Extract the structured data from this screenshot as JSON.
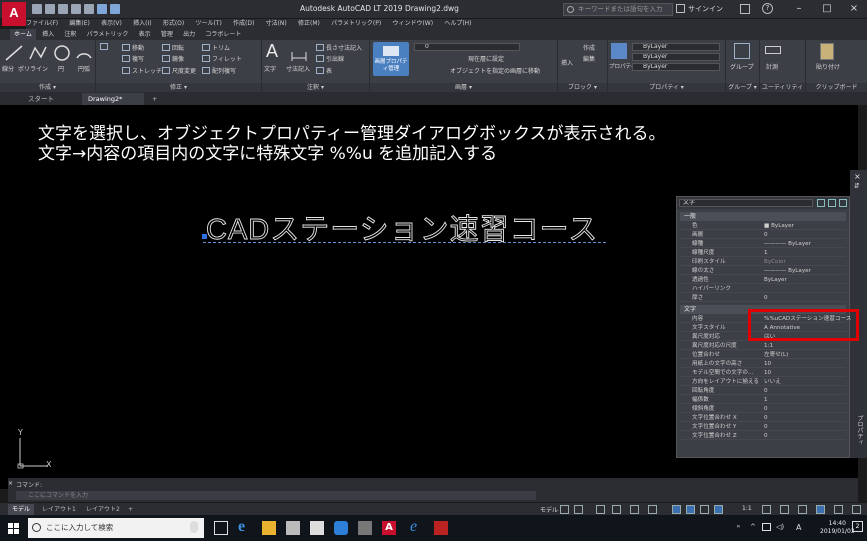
{
  "window": {
    "title": "Autodesk AutoCAD LT 2019    Drawing2.dwg",
    "app_logo": "A",
    "search_placeholder": "キーワードまたは語句を入力",
    "signin_label": "サインイン",
    "controls": [
      "–",
      "□",
      "×"
    ]
  },
  "menubar": [
    "ファイル(F)",
    "編集(E)",
    "表示(V)",
    "挿入(I)",
    "形式(O)",
    "ツール(T)",
    "作成(D)",
    "寸法(N)",
    "修正(M)",
    "パラメトリック(P)",
    "ウィンドウ(W)",
    "ヘルプ(H)"
  ],
  "ribbon_tabs": [
    "ホーム",
    "挿入",
    "注釈",
    "パラメトリック",
    "表示",
    "管理",
    "出力",
    "コラボレート"
  ],
  "ribbon": {
    "draw": {
      "title": "作成 ▾",
      "big_tools": [
        "線分",
        "ポリライン",
        "円",
        "円弧"
      ]
    },
    "modify": {
      "title": "修正 ▾",
      "tools": [
        "移動",
        "回転",
        "トリム",
        "複写",
        "鏡像",
        "フィレット",
        "ストレッチ",
        "尺度変更",
        "配列複写"
      ]
    },
    "annotation": {
      "title": "注釈 ▾",
      "big_tools": [
        "文字",
        "寸法記入"
      ],
      "tools": [
        "長さ寸法記入",
        "引出線",
        "表"
      ]
    },
    "layers": {
      "title": "画層 ▾",
      "big_tool": "画層プロパティ管理",
      "layer_value": "0",
      "tools": [
        "現在層に設定",
        "オブジェクトを指定の画層に移動"
      ]
    },
    "block": {
      "title": "ブロック ▾",
      "tools": [
        "作成",
        "編集",
        "挿入"
      ]
    },
    "properties": {
      "title": "プロパティ ▾",
      "big_tool": "プロパティ コピー",
      "dropdowns": [
        "ByLayer",
        "ByLayer",
        "ByLayer"
      ]
    },
    "groups": {
      "title": "グループ ▾",
      "big_tool": "グループ"
    },
    "utilities": {
      "title": "ユーティリティ ▾",
      "big_tool": "計測"
    },
    "clipboard": {
      "title": "クリップボード",
      "big_tool": "貼り付け"
    }
  },
  "file_tabs": [
    "スタート",
    "Drawing2*",
    "+"
  ],
  "canvas": {
    "instruction_line1": "文字を選択し、オブジェクトプロパティー管理ダイアログボックスが表示される。",
    "instruction_line2": "文字→内容の項目内の文字に特殊文字 %%u を追加記入する",
    "cad_text": "CADステーション速習コース",
    "ucs_labels": {
      "x": "X",
      "y": "Y"
    }
  },
  "properties_palette": {
    "selector": "文字",
    "side_label": "プロパティ",
    "sections": [
      {
        "title": "一般",
        "rows": [
          {
            "key": "色",
            "value": "■ ByLayer"
          },
          {
            "key": "画層",
            "value": "0"
          },
          {
            "key": "線種",
            "value": "———— ByLayer"
          },
          {
            "key": "線種尺度",
            "value": "1"
          },
          {
            "key": "印刷スタイル",
            "value": "ByColor"
          },
          {
            "key": "線の太さ",
            "value": "———— ByLayer"
          },
          {
            "key": "透過性",
            "value": "ByLayer"
          },
          {
            "key": "ハイパーリンク",
            "value": ""
          },
          {
            "key": "厚さ",
            "value": "0"
          }
        ]
      },
      {
        "title": "文字",
        "rows": [
          {
            "key": "内容",
            "value": "%%uCADステーション速習コース"
          },
          {
            "key": "文字スタイル",
            "value": "A Annotative"
          },
          {
            "key": "異尺度対応",
            "value": "はい"
          },
          {
            "key": "異尺度対応の尺度",
            "value": "1:1"
          },
          {
            "key": "位置合わせ",
            "value": "左寄せ(L)"
          },
          {
            "key": "用紙上の文字の高さ",
            "value": "10"
          },
          {
            "key": "モデル空間での文字の...",
            "value": "10"
          },
          {
            "key": "方向をレイアウトに揃える",
            "value": "いいえ"
          },
          {
            "key": "回転角度",
            "value": "0"
          },
          {
            "key": "幅係数",
            "value": "1"
          },
          {
            "key": "傾斜角度",
            "value": "0"
          },
          {
            "key": "文字位置合わせ X",
            "value": "0"
          },
          {
            "key": "文字位置合わせ Y",
            "value": "0"
          },
          {
            "key": "文字位置合わせ Z",
            "value": "0"
          }
        ]
      }
    ]
  },
  "command_line": {
    "label": "コマンド:",
    "placeholder": "ここにコマンドを入力"
  },
  "layout_tabs": [
    "モデル",
    "レイアウト1",
    "レイアウト2",
    "+"
  ],
  "status": {
    "model_label": "モデル",
    "scale": "1:1"
  },
  "taskbar": {
    "search_placeholder": "ここに入力して検索",
    "time": "14:40",
    "date": "2019/01/03",
    "ime": "A",
    "notification_count": "2"
  },
  "colors": {
    "highlight": "#e00000",
    "grip": "#2f6fe0",
    "canvas_bg": "#000000"
  }
}
